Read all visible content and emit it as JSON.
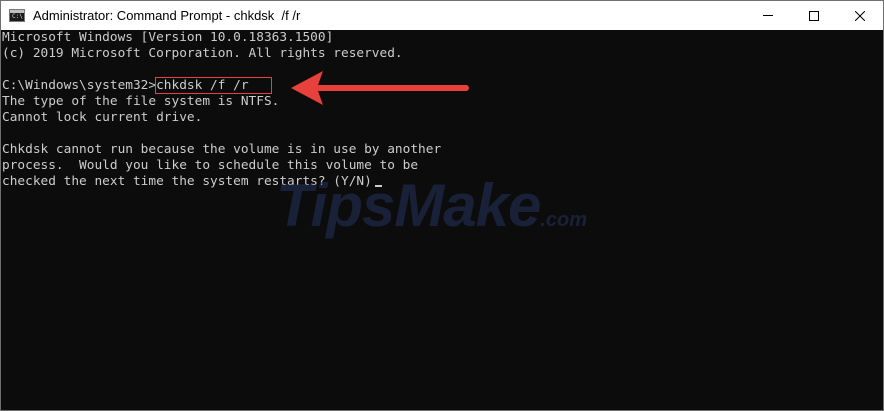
{
  "window": {
    "title": "Administrator: Command Prompt - chkdsk  /f /r",
    "icon": "cmd-icon",
    "icon_glyph": "C:\\",
    "controls": [
      "minimize-icon",
      "maximize-icon",
      "close-icon"
    ]
  },
  "terminal": {
    "lines": [
      "Microsoft Windows [Version 10.0.18363.1500]",
      "(c) 2019 Microsoft Corporation. All rights reserved.",
      "",
      "",
      "The type of the file system is NTFS.",
      "Cannot lock current drive.",
      "",
      "Chkdsk cannot run because the volume is in use by another",
      "process.  Would you like to schedule this volume to be"
    ],
    "prompt": "C:\\Windows\\system32>",
    "command": "chkdsk /f /r",
    "question": "checked the next time the system restarts? (Y/N)",
    "background_color": "#0c0c0c",
    "text_color": "#cccccc"
  },
  "annotation": {
    "highlight_color": "#e8403c",
    "arrow_color": "#e8403c"
  },
  "watermark": {
    "brand": "TipsMake",
    "suffix": ".com"
  }
}
